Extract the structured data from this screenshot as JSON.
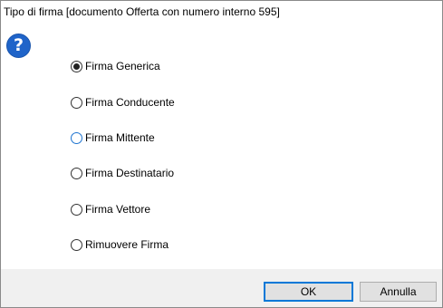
{
  "dialog": {
    "title": "Tipo di firma [documento Offerta con numero interno 595]",
    "icon": "question-icon",
    "icon_glyph": "?"
  },
  "options": [
    {
      "label": "Firma Generica",
      "selected": true
    },
    {
      "label": "Firma Conducente",
      "selected": false
    },
    {
      "label": "Firma Mittente",
      "selected": false,
      "hovered": true
    },
    {
      "label": "Firma Destinatario",
      "selected": false
    },
    {
      "label": "Firma Vettore",
      "selected": false
    },
    {
      "label": "Rimuovere Firma",
      "selected": false
    }
  ],
  "buttons": {
    "ok_label": "OK",
    "cancel_label": "Annulla"
  },
  "colors": {
    "accent": "#0078d7",
    "icon_bg": "#1f64c9",
    "footer_bg": "#f0f0f0"
  }
}
